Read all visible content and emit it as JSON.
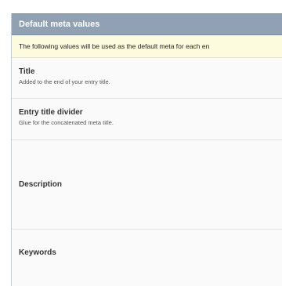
{
  "panel": {
    "title": "Default meta values",
    "notice": "The following values will be used as the default meta for each en"
  },
  "fields": [
    {
      "label": "Title",
      "description": "Added to the end of your entry title."
    },
    {
      "label": "Entry title divider",
      "description": "Glue for the concatenated meta title."
    },
    {
      "label": "Description",
      "description": ""
    },
    {
      "label": "Keywords",
      "description": ""
    }
  ]
}
